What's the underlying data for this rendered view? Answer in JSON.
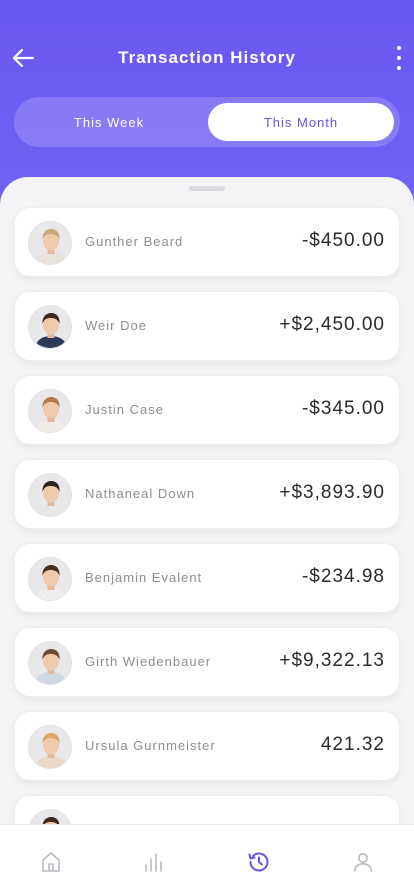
{
  "header": {
    "title": "Transaction History",
    "back_icon": "arrow-left-icon",
    "more_icon": "more-vertical-icon"
  },
  "segment": {
    "left_label": "This Week",
    "right_label": "This Month",
    "selected": "This Month"
  },
  "transactions": [
    {
      "name": "Gunther Beard",
      "amount": "-$450.00",
      "avatar_hair": "#c9a77a",
      "avatar_shirt": "#e8e2da"
    },
    {
      "name": "Weir Doe",
      "amount": "+$2,450.00",
      "avatar_hair": "#3a2a20",
      "avatar_shirt": "#2d3a55"
    },
    {
      "name": "Justin Case",
      "amount": "-$345.00",
      "avatar_hair": "#b07b4a",
      "avatar_shirt": "#f1ece6"
    },
    {
      "name": "Nathaneal Down",
      "amount": "+$3,893.90",
      "avatar_hair": "#2c2420",
      "avatar_shirt": "#e7e7e7"
    },
    {
      "name": "Benjamin Evalent",
      "amount": "-$234.98",
      "avatar_hair": "#4a3022",
      "avatar_shirt": "#eeeeee"
    },
    {
      "name": "Girth Wiedenbauer",
      "amount": "+$9,322.13",
      "avatar_hair": "#6a4a34",
      "avatar_shirt": "#cfd8e3"
    },
    {
      "name": "Ursula Gurnmeister",
      "amount": "421.32",
      "avatar_hair": "#d9a76a",
      "avatar_shirt": "#e9d8c6"
    }
  ],
  "tabs": [
    {
      "icon": "home-icon",
      "active": false
    },
    {
      "icon": "bar-chart-icon",
      "active": false
    },
    {
      "icon": "history-icon",
      "active": true
    },
    {
      "icon": "user-icon",
      "active": false
    }
  ],
  "colors": {
    "primary": "#6a57f2",
    "active_tab": "#6553e8",
    "inactive_tab": "#b9b9c0"
  }
}
